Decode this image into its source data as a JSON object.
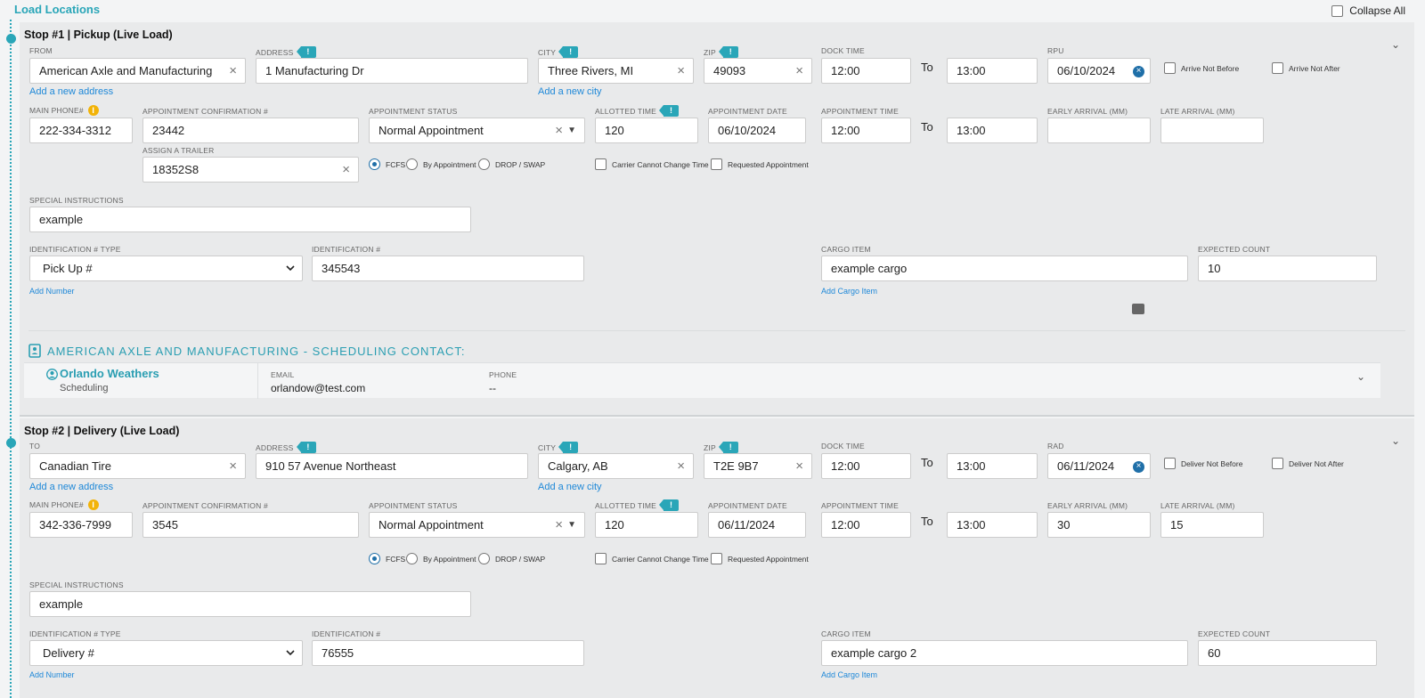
{
  "page": {
    "section_title": "Load Locations",
    "collapse_all_label": "Collapse All"
  },
  "common": {
    "labels": {
      "address": "ADDRESS",
      "city": "CITY",
      "zip": "ZIP",
      "dock_time": "DOCK TIME",
      "main_phone": "MAIN PHONE#",
      "appt_conf": "APPOINTMENT CONFIRMATION #",
      "appt_status": "APPOINTMENT STATUS",
      "allotted_time": "ALLOTTED TIME",
      "appt_date": "APPOINTMENT DATE",
      "appt_time": "APPOINTMENT TIME",
      "early_arrival": "EARLY ARRIVAL (MM)",
      "late_arrival": "LATE ARRIVAL (MM)",
      "assign_trailer": "ASSIGN A TRAILER",
      "special_instructions": "SPECIAL INSTRUCTIONS",
      "id_type": "IDENTIFICATION # TYPE",
      "id_number": "IDENTIFICATION #",
      "cargo_item": "CARGO ITEM",
      "expected_count": "EXPECTED COUNT"
    },
    "to_label": "To",
    "add_address": "Add a new address",
    "add_city": "Add a new city",
    "add_number": "Add Number",
    "add_cargo": "Add Cargo Item",
    "radio": {
      "fcfs": "FCFS",
      "by_appt": "By Appointment",
      "drop_swap": "DROP / SWAP"
    },
    "carrier_cannot_change": "Carrier Cannot Change Time",
    "requested_appt": "Requested Appointment"
  },
  "stop1": {
    "title": "Stop #1 | Pickup (Live Load)",
    "from_label": "FROM",
    "from": "American Axle and Manufacturing",
    "address": "1 Manufacturing Dr",
    "city": "Three Rivers, MI",
    "zip": "49093",
    "dock_start": "12:00",
    "dock_end": "13:00",
    "date_label": "RPU",
    "date": "06/10/2024",
    "not_before": "Arrive Not Before",
    "not_after": "Arrive Not After",
    "phone": "222-334-3312",
    "appt_conf": "23442",
    "appt_status": "Normal Appointment",
    "allotted": "120",
    "appt_date": "06/10/2024",
    "appt_start": "12:00",
    "appt_end": "13:00",
    "early": "",
    "late": "",
    "trailer": "18352S8",
    "instructions": "example",
    "id_type": "Pick Up #",
    "id_number": "345543",
    "cargo": "example cargo",
    "count": "10",
    "contact_heading": "AMERICAN AXLE AND MANUFACTURING - SCHEDULING CONTACT:",
    "contact_name": "Orlando Weathers",
    "contact_role": "Scheduling",
    "email_label": "EMAIL",
    "email": "orlandow@test.com",
    "phone_label": "PHONE",
    "contact_phone": "--"
  },
  "stop2": {
    "title": "Stop #2 | Delivery (Live Load)",
    "to_label": "TO",
    "to": "Canadian Tire",
    "address": "910 57 Avenue Northeast",
    "city": "Calgary, AB",
    "zip": "T2E 9B7",
    "dock_start": "12:00",
    "dock_end": "13:00",
    "date_label": "RAD",
    "date": "06/11/2024",
    "not_before": "Deliver Not Before",
    "not_after": "Deliver Not After",
    "phone": "342-336-7999",
    "appt_conf": "3545",
    "appt_status": "Normal Appointment",
    "allotted": "120",
    "appt_date": "06/11/2024",
    "appt_start": "12:00",
    "appt_end": "13:00",
    "early": "30",
    "late": "15",
    "instructions": "example",
    "id_type": "Delivery #",
    "id_number": "76555",
    "cargo": "example cargo 2",
    "count": "60"
  }
}
